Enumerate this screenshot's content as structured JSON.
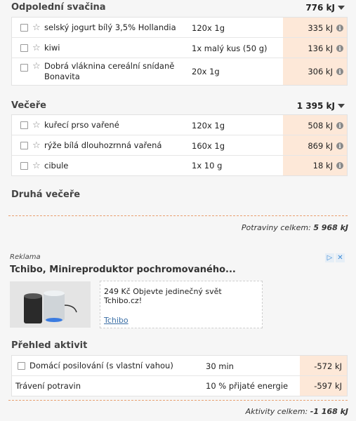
{
  "snack": {
    "title": "Odpolední svačina",
    "total": "776 kJ",
    "items": [
      {
        "name": "selský jogurt bílý 3,5% Hollandia",
        "amount": "120x 1g",
        "kj": "335 kJ"
      },
      {
        "name": "kiwi",
        "amount": "1x malý kus (50 g)",
        "kj": "136 kJ"
      },
      {
        "name": "Dobrá vláknina cereální snídaně Bonavita",
        "amount": "20x 1g",
        "kj": "306 kJ"
      }
    ]
  },
  "dinner": {
    "title": "Večeře",
    "total": "1 395 kJ",
    "items": [
      {
        "name": "kuřecí prso vařené",
        "amount": "120x 1g",
        "kj": "508 kJ"
      },
      {
        "name": "rýže bílá dlouhozrnná vařená",
        "amount": "160x 1g",
        "kj": "869 kJ"
      },
      {
        "name": "cibule",
        "amount": "1x 10 g",
        "kj": "18 kJ"
      }
    ]
  },
  "second_dinner": {
    "title": "Druhá večeře"
  },
  "food_total": {
    "label": "Potraviny celkem:",
    "value": "5 968 kJ"
  },
  "ad": {
    "label": "Reklama",
    "title": "Tchibo, Minireproduktor pochromovaného...",
    "text": "249 Kč Objevte jedinečný svět Tchibo.cz!",
    "link": "Tchibo",
    "info_icon": "▷",
    "close_icon": "✕"
  },
  "activities": {
    "title": "Přehled aktivit",
    "items": [
      {
        "name": "Domácí posilování (s vlastní vahou)",
        "amount": "30 min",
        "kj": "-572 kJ",
        "checkbox": true
      },
      {
        "name": "Trávení potravin",
        "amount": "10 % přijaté energie",
        "kj": "-597 kJ",
        "checkbox": false
      }
    ]
  },
  "activity_total": {
    "label": "Aktivity celkem:",
    "value": "-1 168 kJ"
  },
  "icons": {
    "star": "☆",
    "info": "i"
  },
  "colors": {
    "kj_cell": "#fde8d8",
    "divider": "#e8a070",
    "ad_link": "#3a6ea5"
  }
}
